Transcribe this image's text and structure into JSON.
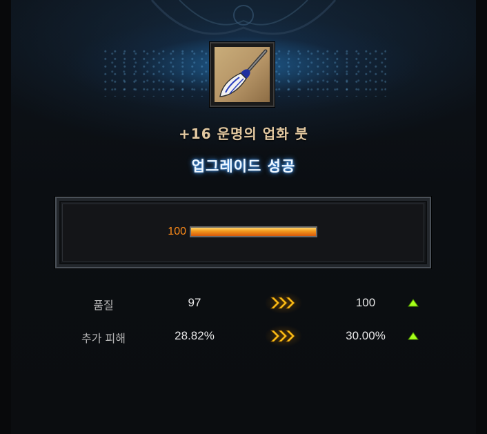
{
  "item": {
    "name": "+16 운명의 업화 붓",
    "icon": "brush-icon"
  },
  "result_text": "업그레이드 성공",
  "gauge": {
    "value": "100",
    "fill_fraction": 1.0
  },
  "stats": [
    {
      "label": "품질",
      "before": "97",
      "after": "100",
      "arrow_icon": "triple-chevron-right-icon",
      "change_icon": "triangle-up-icon"
    },
    {
      "label": "추가 피해",
      "before": "28.82%",
      "after": "30.00%",
      "arrow_icon": "triple-chevron-right-icon",
      "change_icon": "triangle-up-icon"
    }
  ],
  "colors": {
    "accent_orange": "#ff8c1a",
    "item_name": "#e2c8a0",
    "success_glow": "#46a0ff",
    "arrow_gold": "#ffc21a",
    "up_green": "#a6ff1a"
  }
}
